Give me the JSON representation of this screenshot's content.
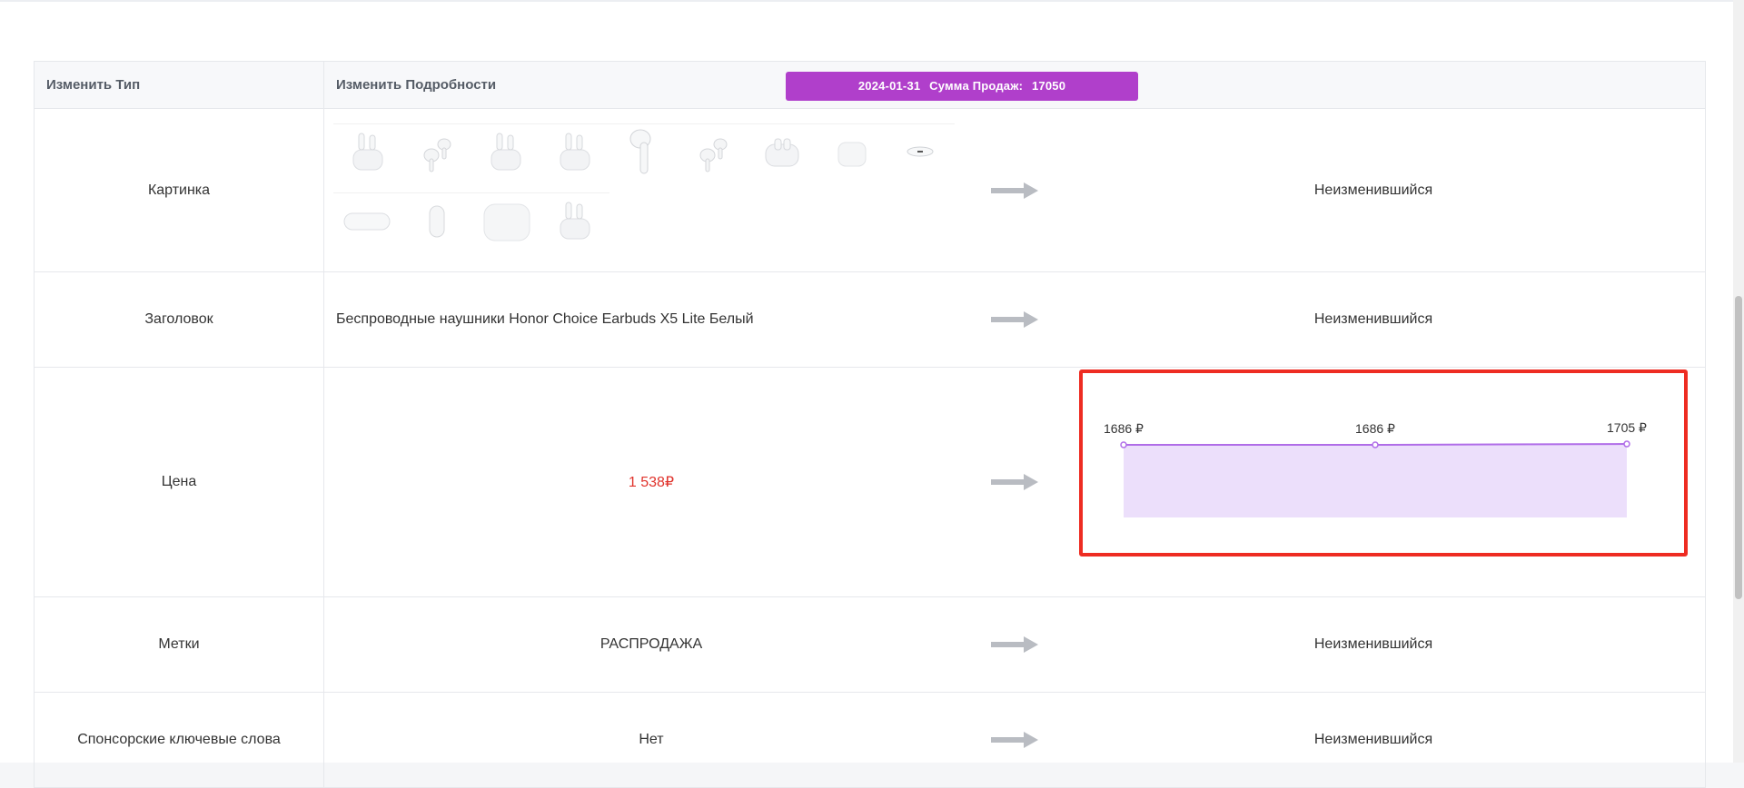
{
  "table": {
    "header": {
      "type_col": "Изменить Тип",
      "details_col": "Изменить Подробности"
    },
    "sales_badge": {
      "date": "2024-01-31",
      "label": "Сумма Продаж:",
      "value": "17050",
      "color": "#b03fcb"
    },
    "rows": [
      {
        "type": "Картинка",
        "new": "Неизменившийся"
      },
      {
        "type": "Заголовок",
        "old": "Беспроводные наушники Honor Choice Earbuds X5 Lite Белый",
        "new": "Неизменившийся"
      },
      {
        "type": "Цена",
        "old": "1 538₽"
      },
      {
        "type": "Метки",
        "old": "РАСПРОДАЖА",
        "new": "Неизменившийся"
      },
      {
        "type": "Спонсорские ключевые слова",
        "old": "Нет",
        "new": "Неизменившийся"
      }
    ],
    "thumbnail_icons": [
      "earbuds-case-open-icon",
      "earbuds-pair-icon",
      "earbuds-case-open-icon",
      "earbuds-case-open-icon",
      "single-earbud-icon",
      "earbuds-pair-icon",
      "earbuds-case-icon",
      "earbuds-case-closed-icon",
      "case-top-icon",
      "case-side-icon",
      "earbud-side-icon",
      "case-closed-icon",
      "earbuds-case-open-icon"
    ],
    "arrow_icon": "arrow-right-icon"
  },
  "chart_data": {
    "type": "area",
    "x": [
      "",
      "",
      ""
    ],
    "values": [
      1686,
      1686,
      1705
    ],
    "data_labels": [
      "1686 ₽",
      "1686 ₽",
      "1705 ₽"
    ],
    "line_color": "#b06de8",
    "fill_color": "#ecdffb",
    "highlight_border": "#ee2c22"
  }
}
